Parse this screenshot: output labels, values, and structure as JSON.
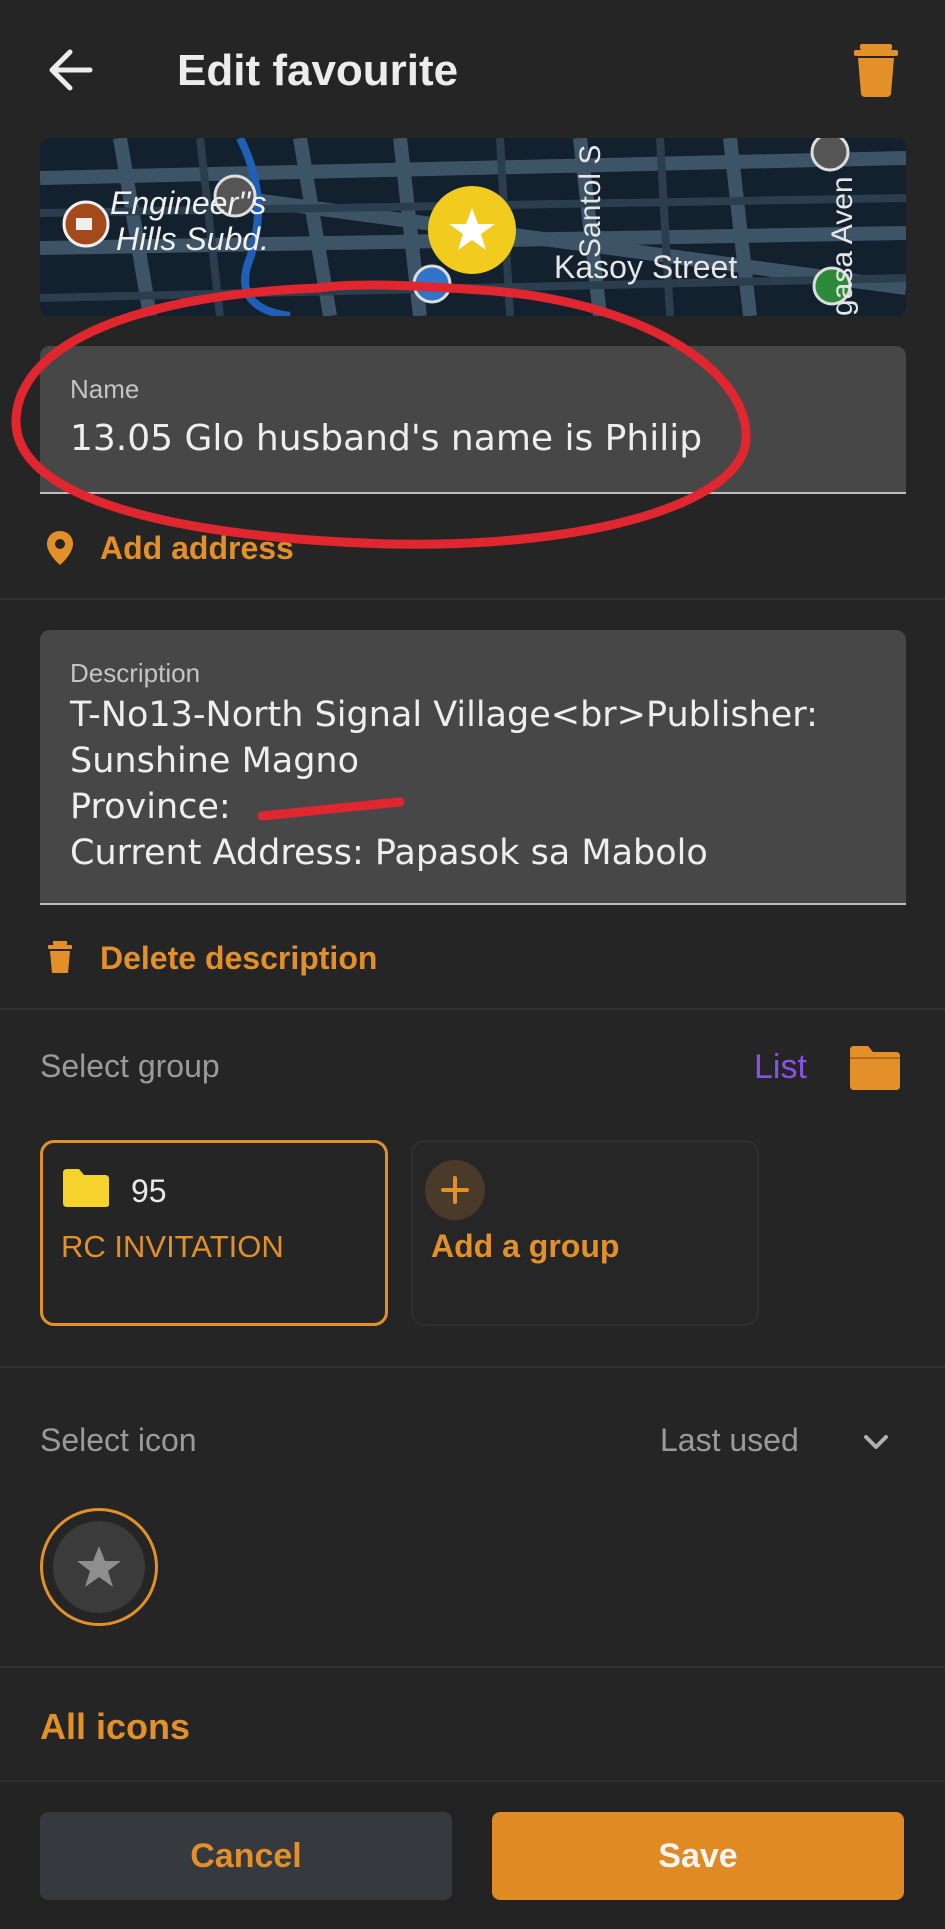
{
  "header": {
    "title": "Edit favourite",
    "back_icon": "arrow-left-icon",
    "delete_icon": "trash-icon"
  },
  "map": {
    "labels": [
      "Engineer''s",
      "Hills Subd.",
      "Santol S",
      "Kasoy Street",
      "gasa Aven"
    ],
    "marker_icon": "star-icon"
  },
  "name_field": {
    "label": "Name",
    "value": "13.05 Glo husband's name is Philip"
  },
  "add_address": {
    "label": "Add address",
    "icon": "location-pin-icon"
  },
  "description_field": {
    "label": "Description",
    "value": "T-No13-North Signal Village<br>Publisher:\nSunshine Magno\nProvince:\nCurrent Address: Papasok sa Mabolo"
  },
  "delete_description": {
    "label": "Delete description",
    "icon": "trash-icon"
  },
  "group_section": {
    "label": "Select group",
    "list_label": "List",
    "folder_icon": "folder-icon",
    "groups": [
      {
        "count": "95",
        "name": "RC INVITATION",
        "icon": "folder-icon"
      }
    ],
    "add_group_label": "Add a group"
  },
  "icon_section": {
    "label": "Select icon",
    "filter_label": "Last used",
    "selected_icon": "star-icon",
    "all_icons_label": "All icons"
  },
  "footer": {
    "cancel_label": "Cancel",
    "save_label": "Save"
  },
  "colors": {
    "background": "#252525",
    "accent": "#e3902a",
    "field": "#474747",
    "list_link": "#8a52e8",
    "annotation": "#e0262e"
  }
}
